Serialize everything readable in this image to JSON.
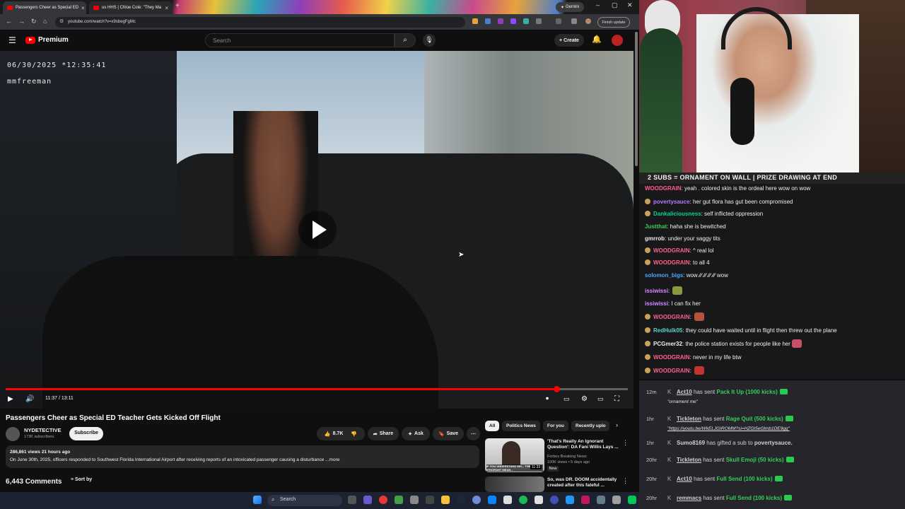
{
  "browser": {
    "tabs": [
      {
        "title": "Passengers Cheer as Special ED"
      },
      {
        "title": "us HHS | Chloe Cole: \"They Ma"
      }
    ],
    "gemini_label": "Gemini",
    "url": "youtube.com/watch?v=x9sbegFgMc",
    "finish_update": "Finish update"
  },
  "youtube": {
    "logo_text": "Premium",
    "search_placeholder": "Search",
    "create_label": "Create",
    "video": {
      "timestamp_overlay": "06/30/2025 *12:35:41",
      "officer_overlay": "mmfreeman",
      "current_time": "11:37 / 13:11",
      "progress": 0.885
    },
    "title": "Passengers Cheer as Special ED Teacher Gets Kicked Off Flight",
    "channel": {
      "name": "NYDETECTIVE",
      "subs": "173K subscribers"
    },
    "subscribe_label": "Subscribe",
    "actions": {
      "likes": "8.7K",
      "share": "Share",
      "ask": "Ask",
      "save": "Save"
    },
    "description": {
      "meta": "286,861 views  21 hours ago",
      "text": "On June 30th, 2025, officers responded to Southwest Florida International Airport after receiving reports of an intoxicated passenger causing a disturbance ...more"
    },
    "comments_count": "6,443 Comments",
    "sort_by": "Sort by",
    "chips": [
      "All",
      "Politics News",
      "For you",
      "Recently uplo"
    ],
    "recommended": [
      {
        "title": "'That's Really An Ignorant Question': DA Fani Willis Lays ...",
        "channel": "Forbes Breaking News",
        "meta": "100K views • 5 days ago",
        "badge": "New",
        "duration": "11:33",
        "thumb_caption": "IF YOU UNDERSTAND WH... THE WORD IGNORANT MEAN..."
      },
      {
        "title": "So, was DR. DOOM accidentally created after this fateful ...",
        "channel": "",
        "meta": "",
        "badge": "",
        "duration": "",
        "thumb_caption": ""
      }
    ]
  },
  "taskbar": {
    "search": "Search"
  },
  "stream": {
    "banner": "2 SUBS = ORNAMENT ON WALL | PRIZE DRAWING AT END",
    "chat": [
      {
        "user": "WOODGRAIN",
        "color": "#ff5f8a",
        "text": "yeah . colored skin is the ordeal here wow on wow"
      },
      {
        "user": "povertysauce",
        "color": "#b57bff",
        "text": "her gut flora has gut been compromised"
      },
      {
        "user": "Dankaliciousness",
        "color": "#00d68f",
        "text": "self inflicted oppression"
      },
      {
        "user": "Justthat",
        "color": "#3bd14a",
        "text": "haha she is bewitched"
      },
      {
        "user": "gmrrob",
        "color": "#efeff1",
        "text": "under your saggy tits"
      },
      {
        "user": "WOODGRAIN",
        "color": "#ff5f8a",
        "text": "^ real lol"
      },
      {
        "user": "WOODGRAIN",
        "color": "#ff5f8a",
        "text": "to all 4"
      },
      {
        "user": "solomon_bigs",
        "color": "#4aa8ff",
        "text": "wow ∕∕∕ ∕∕∕ ∕∕∕ ∕∕∕ wow"
      },
      {
        "user": "issiwissi",
        "color": "#d48cff",
        "text": ""
      },
      {
        "user": "issiwissi",
        "color": "#d48cff",
        "text": "I can fix her"
      },
      {
        "user": "WOODGRAIN",
        "color": "#ff5f8a",
        "text": ""
      },
      {
        "user": "RedHulk05",
        "color": "#5fd0c8",
        "text": "they could have waited until in flight then threw out the plane"
      },
      {
        "user": "PCGmer32",
        "color": "#efeff1",
        "text": "the police station exists for people like her"
      },
      {
        "user": "WOODGRAIN",
        "color": "#ff5f8a",
        "text": "never in my life btw"
      },
      {
        "user": "WOODGRAIN",
        "color": "#ff5f8a",
        "text": ""
      }
    ],
    "events": [
      {
        "time": "12m",
        "user": "Act10",
        "action": "has sent",
        "item": "Pack It Up (1000 kicks)",
        "note": "\"ornament me\""
      },
      {
        "time": "1hr",
        "user": "Tickleton",
        "action": "has sent",
        "item": "Rage Quit (500 kicks)",
        "note": "\"https://youtu.be/WkELJGIROMM?si=HZGI5eGlmb1DE9gg\""
      },
      {
        "time": "1hr",
        "user": "Sumo8169",
        "action": "has gifted a sub to",
        "item": "povertysauce.",
        "note": ""
      },
      {
        "time": "20hr",
        "user": "Tickleton",
        "action": "has sent",
        "item": "Skull Emoji (50 kicks)",
        "note": ""
      },
      {
        "time": "20hr",
        "user": "Act10",
        "action": "has sent",
        "item": "Full Send (100 kicks)",
        "note": ""
      },
      {
        "time": "20hr",
        "user": "remmacs",
        "action": "has sent",
        "item": "Full Send (100 kicks)",
        "note": ""
      }
    ]
  }
}
